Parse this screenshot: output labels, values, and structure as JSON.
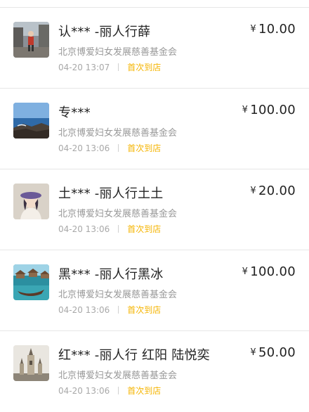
{
  "currency_symbol": "¥",
  "tag_color": "#f5b400",
  "donations": [
    {
      "name": "认*** -丽人行薛",
      "amount": "10.00",
      "org": "北京博爱妇女发展慈善基金会",
      "time": "04-20 13:07",
      "tag": "首次到店",
      "avatar": "photo-person-walking"
    },
    {
      "name": "专***",
      "amount": "100.00",
      "org": "北京博爱妇女发展慈善基金会",
      "time": "04-20 13:06",
      "tag": "首次到店",
      "avatar": "photo-seascape"
    },
    {
      "name": "土*** -丽人行土土",
      "amount": "20.00",
      "org": "北京博爱妇女发展慈善基金会",
      "time": "04-20 13:06",
      "tag": "首次到店",
      "avatar": "illustration-girl-hat"
    },
    {
      "name": "黑*** -丽人行黑冰",
      "amount": "100.00",
      "org": "北京博爱妇女发展慈善基金会",
      "time": "04-20 13:06",
      "tag": "首次到店",
      "avatar": "photo-water-villas"
    },
    {
      "name": "红*** -丽人行 红阳 陆悦奕",
      "amount": "50.00",
      "org": "北京博爱妇女发展慈善基金会",
      "time": "04-20 13:06",
      "tag": "首次到店",
      "avatar": "photo-temple"
    }
  ]
}
